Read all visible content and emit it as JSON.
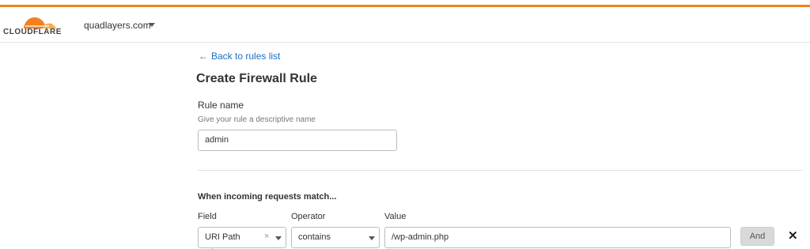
{
  "header": {
    "logo_text": "CLOUDFLARE",
    "account_name": "quadlayers.com",
    "accent_color": "#f38020"
  },
  "nav": {
    "back_label": "Back to rules list",
    "back_icon": "arrow-left-icon"
  },
  "page": {
    "title": "Create Firewall Rule"
  },
  "rule_name": {
    "label": "Rule name",
    "help": "Give your rule a descriptive name",
    "value": "admin"
  },
  "expression": {
    "title": "When incoming requests match...",
    "field_label": "Field",
    "operator_label": "Operator",
    "value_label": "Value",
    "field_value": "URI Path",
    "operator_value": "contains",
    "value_value": "/wp-admin.php",
    "and_label": "And",
    "clear_icon": "clear-icon",
    "remove_icon": "close-icon"
  }
}
